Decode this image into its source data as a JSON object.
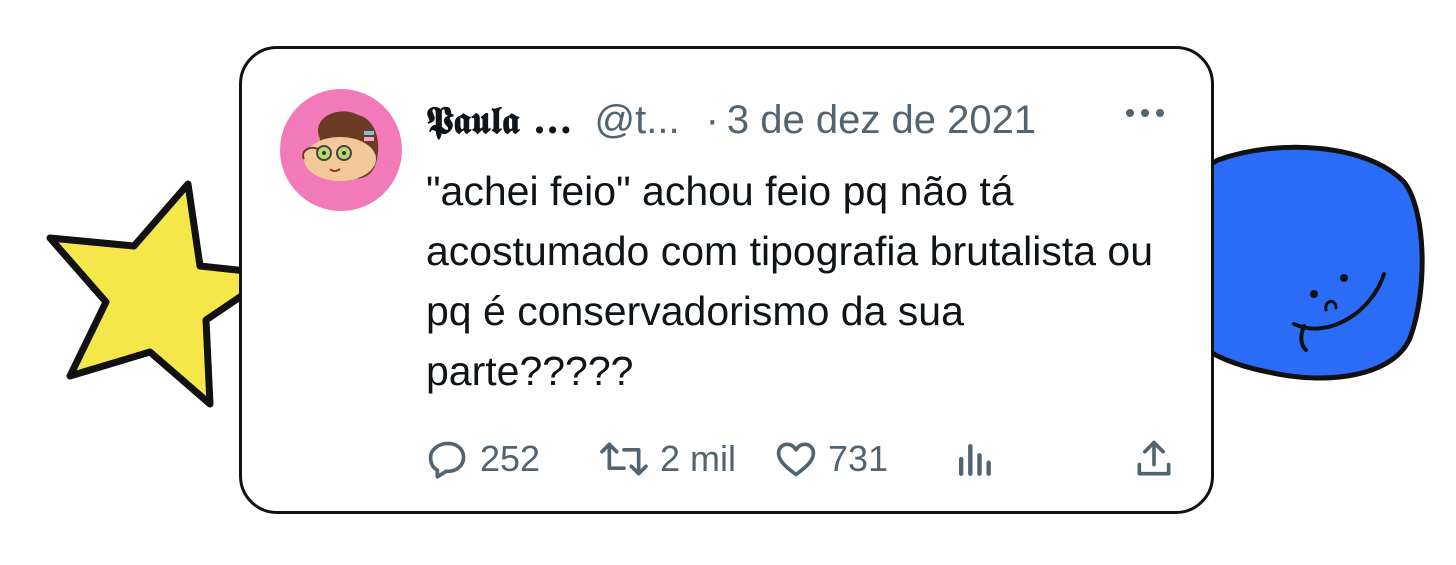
{
  "tweet": {
    "author_name": "𝕻𝖆𝖚𝖑𝖆 ...",
    "handle": "@t...",
    "separator": "·",
    "date": "3 de dez de 2021",
    "text": "\"achei feio\" achou feio pq não tá acostumado com tipografia brutalista ou pq é conservadorismo da sua parte?????",
    "replies": "252",
    "retweets": "2 mil",
    "likes": "731"
  },
  "icons": {
    "reply": "reply-icon",
    "retweet": "retweet-icon",
    "like": "heart-icon",
    "views": "analytics-icon",
    "share": "share-icon",
    "more": "more-icon"
  },
  "colors": {
    "star_fill": "#f5e64a",
    "blob_fill": "#2b6cf6",
    "avatar_bg": "#f27ab8",
    "muted_text": "#536471"
  }
}
